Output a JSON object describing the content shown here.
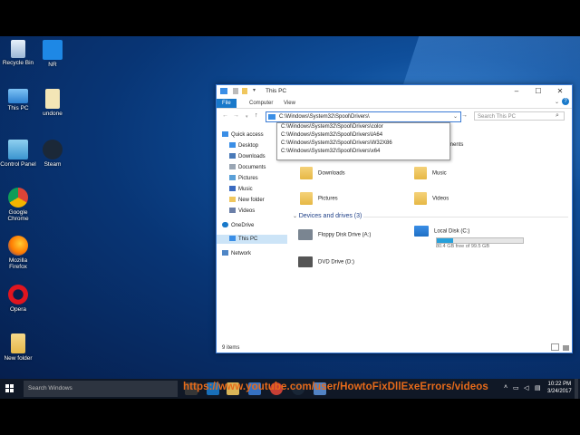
{
  "desktop_icons": [
    {
      "label": "Recycle Bin",
      "icon": "recycle-bin-icon"
    },
    {
      "label": "NR",
      "icon": "nr-app-icon"
    },
    {
      "label": "This PC",
      "icon": "this-pc-icon"
    },
    {
      "label": "undone",
      "icon": "document-icon"
    },
    {
      "label": "Control Panel",
      "icon": "control-panel-icon"
    },
    {
      "label": "Steam",
      "icon": "steam-icon"
    },
    {
      "label": "Google Chrome",
      "icon": "chrome-icon"
    },
    {
      "label": "Mozilla Firefox",
      "icon": "firefox-icon"
    },
    {
      "label": "Opera",
      "icon": "opera-icon"
    },
    {
      "label": "New folder",
      "icon": "folder-icon"
    }
  ],
  "window": {
    "title": "This PC",
    "ribbon_tabs": [
      "File",
      "Computer",
      "View"
    ],
    "address_value": "C:\\Windows\\System32\\Spool\\Drivers\\",
    "search_placeholder": "Search This PC",
    "suggestions": [
      "C:\\Windows\\System32\\Spool\\Drivers\\color",
      "C:\\Windows\\System32\\Spool\\Drivers\\IA64",
      "C:\\Windows\\System32\\Spool\\Drivers\\W32X86",
      "C:\\Windows\\System32\\Spool\\Drivers\\x64"
    ],
    "nav": {
      "quick_access": "Quick access",
      "items": [
        "Desktop",
        "Downloads",
        "Documents",
        "Pictures",
        "Music",
        "New folder",
        "Videos"
      ],
      "onedrive": "OneDrive",
      "this_pc": "This PC",
      "network": "Network"
    },
    "folders_partial_label": "ments",
    "folders": [
      "Downloads",
      "Music",
      "Pictures",
      "Videos"
    ],
    "devices_heading": "Devices and drives (3)",
    "drives": [
      {
        "name": "Floppy Disk Drive (A:)"
      },
      {
        "name": "Local Disk (C:)",
        "free": "80.4 GB free of 99.5 GB",
        "used_fraction": 0.19
      },
      {
        "name": "DVD Drive (D:)"
      }
    ],
    "status": "9 items"
  },
  "taskbar": {
    "search_placeholder": "Search Windows",
    "overlay_url": "https://www.youtube.com/user/HowtoFixDllExeErrors/videos",
    "time": "10:22 PM",
    "date": "3/24/2017"
  },
  "colors": {
    "accent": "#1979ca",
    "url_overlay": "#e66a1a"
  }
}
